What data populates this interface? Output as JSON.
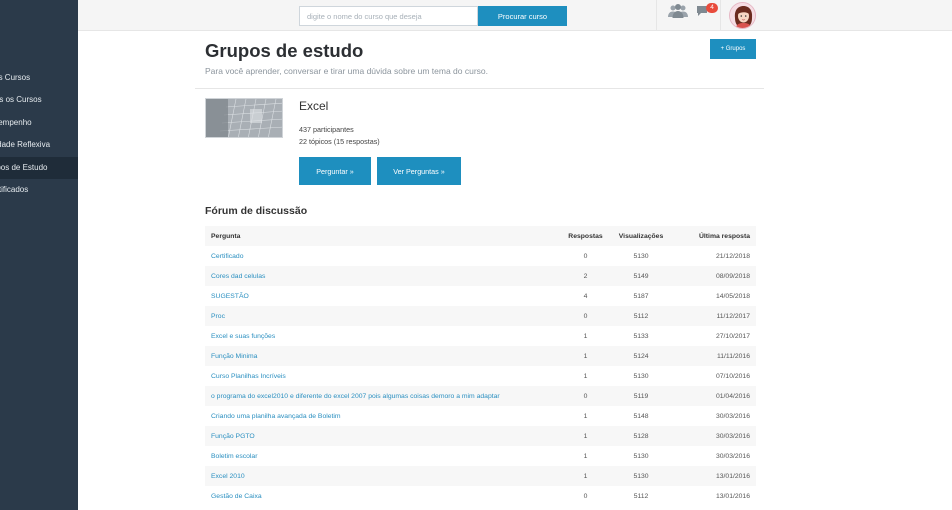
{
  "sidebar": {
    "items": [
      {
        "label": "Meus Cursos",
        "active": false
      },
      {
        "label": "Todos os Cursos",
        "active": false
      },
      {
        "label": "Desempenho",
        "active": false
      },
      {
        "label": "Atividade Reflexiva",
        "active": false
      },
      {
        "label": "Grupos de Estudo",
        "active": true
      },
      {
        "label": "Certificados",
        "active": false
      }
    ]
  },
  "header": {
    "search_placeholder": "digite o nome do curso que deseja",
    "search_button": "Procurar curso",
    "notification_count": "4",
    "icons": [
      "people-icon",
      "chat-icon",
      "avatar"
    ]
  },
  "page": {
    "title": "Grupos de estudo",
    "subtitle": "Para você aprender, conversar e tirar uma dúvida sobre um tema do curso.",
    "add_button": "+ Grupos"
  },
  "course": {
    "name": "Excel",
    "participants": "437 participantes",
    "topics": "22 tópicos (15 respostas)",
    "ask_button": "Perguntar »",
    "view_button": "Ver Perguntas »"
  },
  "forum": {
    "title": "Fórum de discussão",
    "headers": {
      "question": "Pergunta",
      "answers": "Respostas",
      "views": "Visualizações",
      "last": "Última resposta"
    },
    "rows": [
      {
        "question": "Certificado",
        "answers": "0",
        "views": "5130",
        "last": "21/12/2018"
      },
      {
        "question": "Cores dad celulas",
        "answers": "2",
        "views": "5149",
        "last": "08/09/2018"
      },
      {
        "question": "SUGESTÃO",
        "answers": "4",
        "views": "5187",
        "last": "14/05/2018"
      },
      {
        "question": "Proc",
        "answers": "0",
        "views": "5112",
        "last": "11/12/2017"
      },
      {
        "question": "Excel e suas funções",
        "answers": "1",
        "views": "5133",
        "last": "27/10/2017"
      },
      {
        "question": "Função Minima",
        "answers": "1",
        "views": "5124",
        "last": "11/11/2016"
      },
      {
        "question": "Curso Planilhas Incríveis",
        "answers": "1",
        "views": "5130",
        "last": "07/10/2016"
      },
      {
        "question": "o programa do excel2010 e diferente do excel 2007 pois algumas coisas demoro a mim adaptar",
        "answers": "0",
        "views": "5119",
        "last": "01/04/2016"
      },
      {
        "question": "Criando uma planilha avançada de Boletim",
        "answers": "1",
        "views": "5148",
        "last": "30/03/2016"
      },
      {
        "question": "Função PGTO",
        "answers": "1",
        "views": "5128",
        "last": "30/03/2016"
      },
      {
        "question": "Boletim escolar",
        "answers": "1",
        "views": "5130",
        "last": "30/03/2016"
      },
      {
        "question": "Excel 2010",
        "answers": "1",
        "views": "5130",
        "last": "13/01/2016"
      },
      {
        "question": "Gestão de Caixa",
        "answers": "0",
        "views": "5112",
        "last": "13/01/2016"
      }
    ]
  },
  "colors": {
    "sidebar_bg": "#2b3a4a",
    "accent": "#1e8fbf",
    "link": "#2a8fc0",
    "badge": "#e84b3c"
  }
}
